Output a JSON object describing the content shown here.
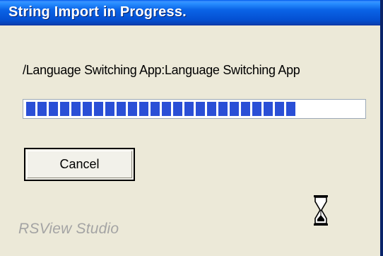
{
  "window": {
    "title": "String Import in Progress."
  },
  "status": {
    "path_text": "/Language Switching App:Language Switching App"
  },
  "progress": {
    "fraction": 0.83
  },
  "buttons": {
    "cancel_label": "Cancel"
  },
  "icons": {
    "busy": "hourglass-icon"
  },
  "footer": {
    "brand": "RSView Studio"
  },
  "colors": {
    "titlebar": "#0a63e6",
    "progress_block": "#2a4fd6",
    "dialog_bg": "#ece9d8"
  }
}
